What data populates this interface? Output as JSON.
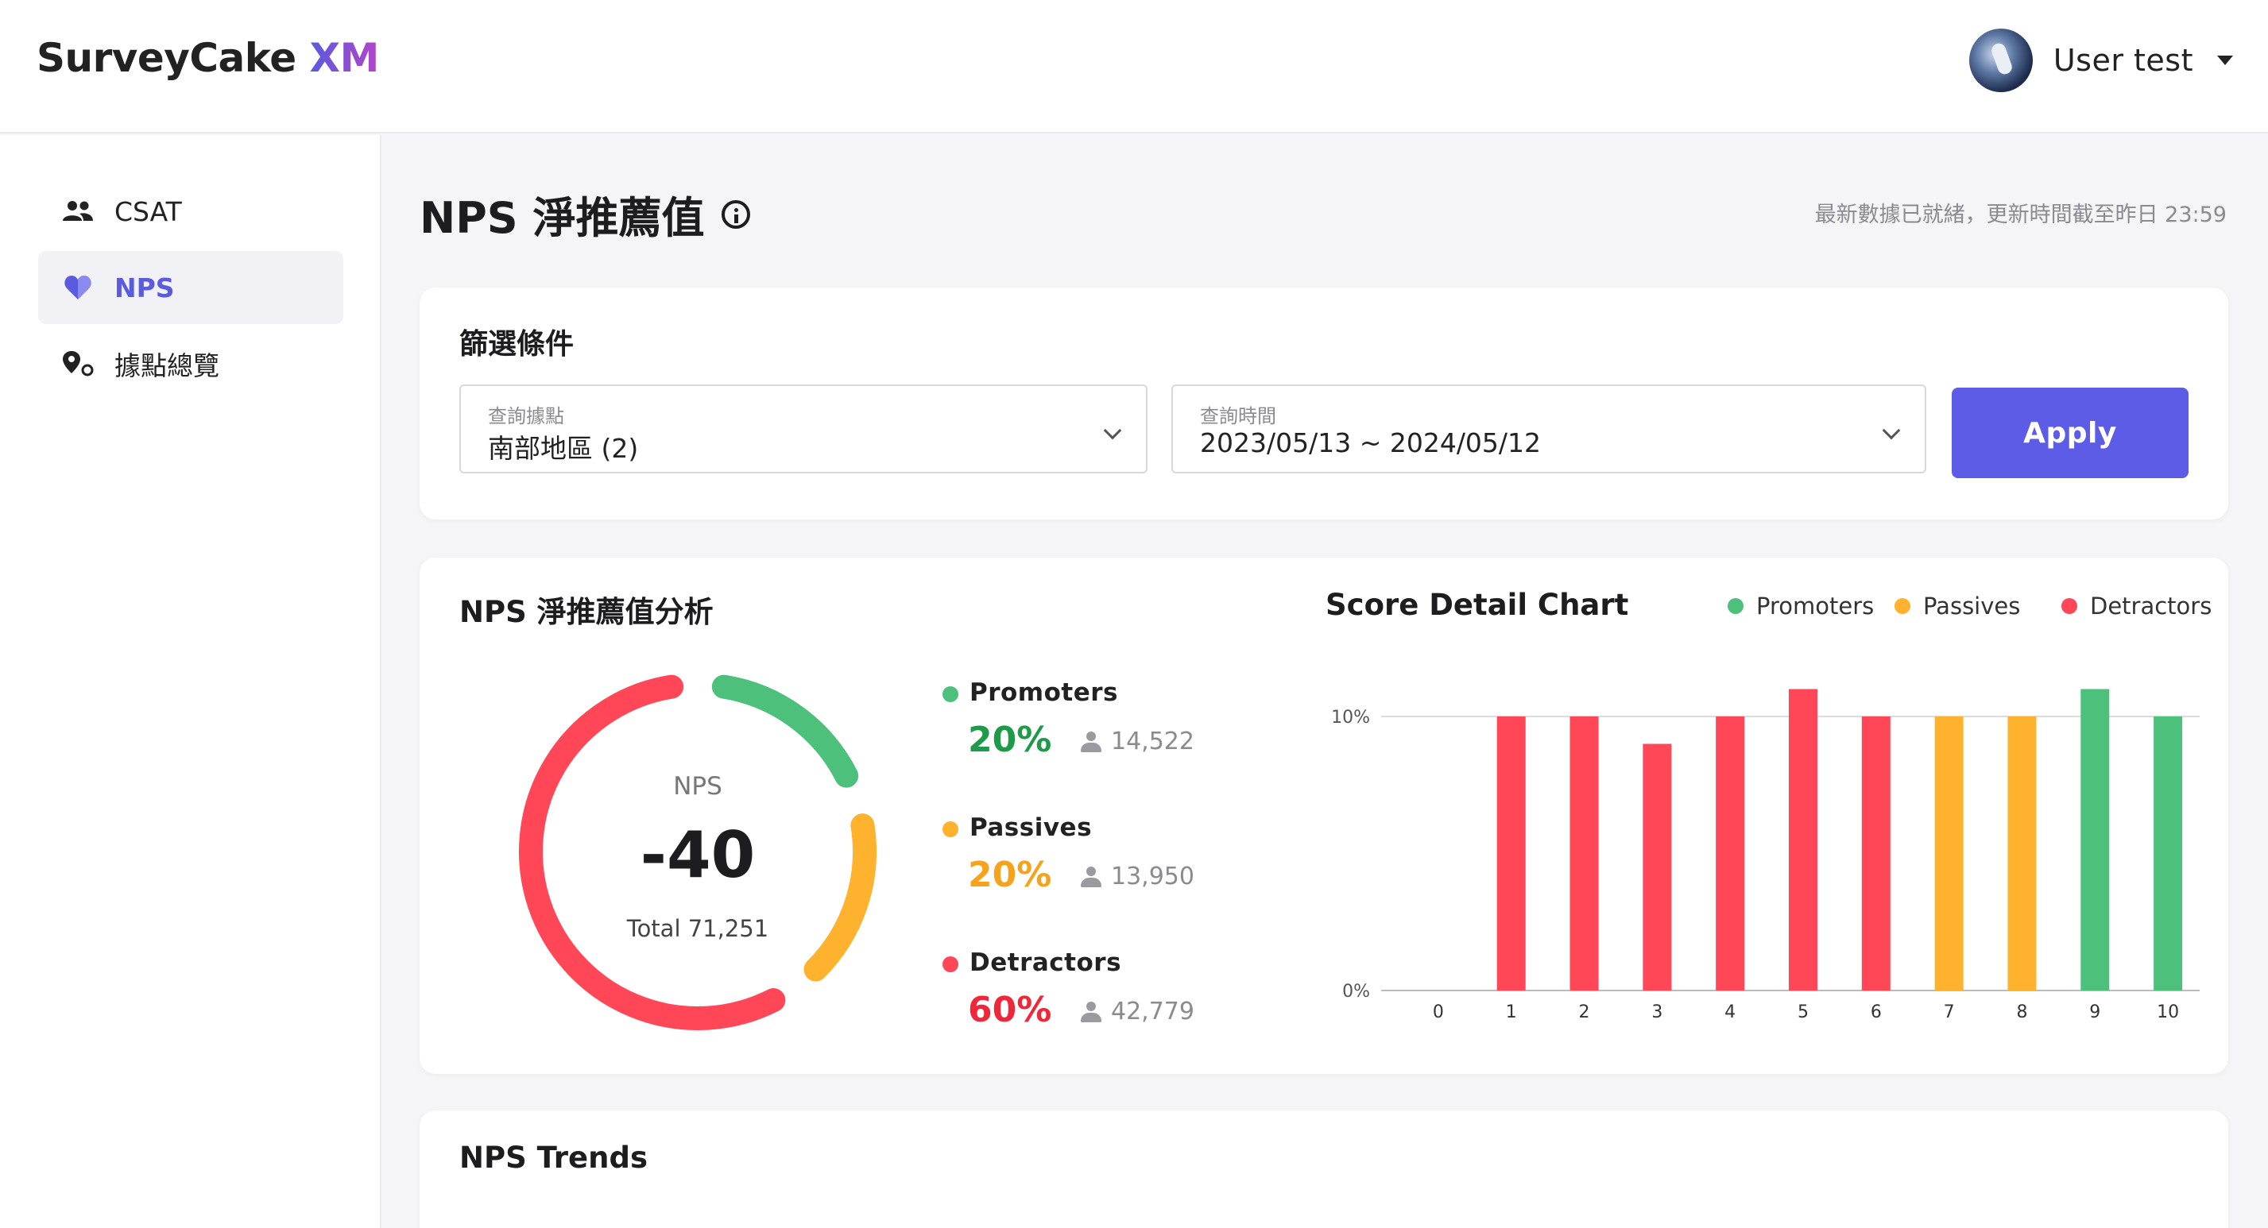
{
  "app": {
    "logo_main": "SurveyCake ",
    "logo_suffix": "XM",
    "user_name": "User test"
  },
  "sidebar": {
    "items": [
      {
        "label": "CSAT",
        "icon": "people-icon",
        "active": false
      },
      {
        "label": "NPS",
        "icon": "heart-icon",
        "active": true
      },
      {
        "label": "據點總覽",
        "icon": "location-pin-icon",
        "active": false
      }
    ]
  },
  "page": {
    "title": "NPS 淨推薦值",
    "update_note": "最新數據已就緒，更新時間截至昨日 23:59"
  },
  "filter": {
    "title": "篩選條件",
    "location": {
      "label": "查詢據點",
      "value": "南部地區 (2)"
    },
    "time": {
      "label": "查詢時間",
      "value": "2023/05/13 ~ 2024/05/12"
    },
    "apply_label": "Apply"
  },
  "nps_analysis": {
    "title": "NPS 淨推薦值分析",
    "center_label": "NPS",
    "score": "-40",
    "total": "Total 71,251",
    "segments": [
      {
        "name": "Promoters",
        "pct": "20%",
        "count": "14,522",
        "color": "#4dc07c",
        "text_color": "#1e9a4a"
      },
      {
        "name": "Passives",
        "pct": "20%",
        "count": "13,950",
        "color": "#ffb22e",
        "text_color": "#f5a31c"
      },
      {
        "name": "Detractors",
        "pct": "60%",
        "count": "42,779",
        "color": "#ff4757",
        "text_color": "#f0263a"
      }
    ]
  },
  "chart_data": {
    "type": "bar",
    "title": "Score Detail Chart",
    "legend": [
      "Promoters",
      "Passives",
      "Detractors"
    ],
    "legend_position": "top-right",
    "categories": [
      "0",
      "1",
      "2",
      "3",
      "4",
      "5",
      "6",
      "7",
      "8",
      "9",
      "10"
    ],
    "values": [
      0,
      10,
      10,
      9,
      10,
      11,
      10,
      10,
      10,
      11,
      10
    ],
    "colors": [
      "#ff4757",
      "#ff4757",
      "#ff4757",
      "#ff4757",
      "#ff4757",
      "#ff4757",
      "#ff4757",
      "#ffb22e",
      "#ffb22e",
      "#4dc07c",
      "#4dc07c"
    ],
    "yticks": [
      "0%",
      "10%"
    ],
    "ylim": [
      0,
      10
    ],
    "grid": true
  },
  "trends": {
    "title": "NPS Trends"
  }
}
